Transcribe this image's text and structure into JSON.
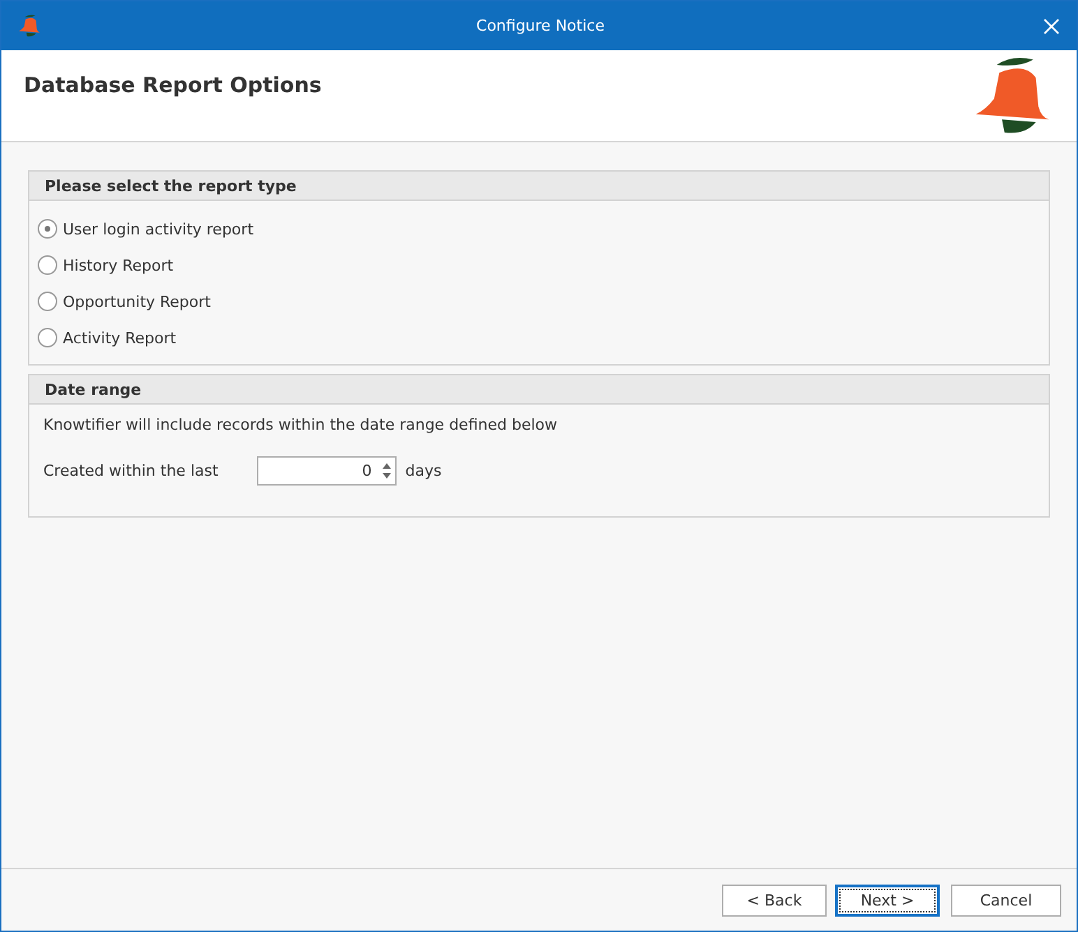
{
  "window": {
    "title": "Configure Notice"
  },
  "header": {
    "title": "Database Report Options"
  },
  "report_type": {
    "title": "Please select the report type",
    "options": [
      {
        "label": "User login activity report",
        "selected": true
      },
      {
        "label": "History Report",
        "selected": false
      },
      {
        "label": "Opportunity Report",
        "selected": false
      },
      {
        "label": "Activity Report",
        "selected": false
      }
    ]
  },
  "date_range": {
    "title": "Date range",
    "description": "Knowtifier will include records within the date range defined below",
    "field_label": "Created within the last",
    "value": "0",
    "unit": "days"
  },
  "buttons": [
    {
      "label": "< Back",
      "focused": false
    },
    {
      "label": "Next >",
      "focused": true
    },
    {
      "label": "Cancel",
      "focused": false
    }
  ]
}
